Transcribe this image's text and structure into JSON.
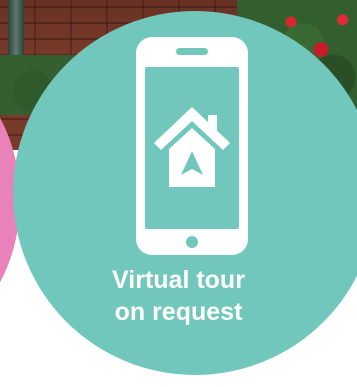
{
  "caption": {
    "line1": "Virtual tour",
    "line2": "on request"
  },
  "icon": "smartphone-home-icon",
  "colors": {
    "main_circle": "#72c7bc",
    "left_circle": "#e882b8",
    "right_circle": "#9b7fcc",
    "text": "#ffffff"
  }
}
